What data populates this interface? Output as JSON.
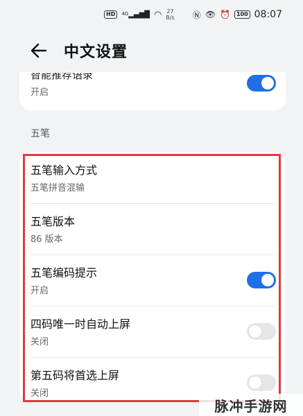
{
  "status_bar": {
    "hd_badge": "HD",
    "signal_label": "4G",
    "net_speed_value": "27",
    "net_speed_unit": "B/s",
    "battery": "100",
    "time": "08:07"
  },
  "header": {
    "title": "中文设置"
  },
  "top_card": {
    "title": "智能推荐语录",
    "subtitle": "开启",
    "toggle_on": true
  },
  "section": {
    "label": "五笔"
  },
  "rows": [
    {
      "title": "五笔输入方式",
      "subtitle": "五笔拼音混输",
      "has_toggle": false
    },
    {
      "title": "五笔版本",
      "subtitle": "86 版本",
      "has_toggle": false
    },
    {
      "title": "五笔编码提示",
      "subtitle": "开启",
      "has_toggle": true,
      "toggle_on": true
    },
    {
      "title": "四码唯一时自动上屏",
      "subtitle": "关闭",
      "has_toggle": true,
      "toggle_on": false
    },
    {
      "title": "第五码将首选上屏",
      "subtitle": "关闭",
      "has_toggle": true,
      "toggle_on": false
    }
  ],
  "colors": {
    "accent": "#1f6fe6",
    "highlight_border": "#e0393e",
    "background": "#f1f3f5"
  },
  "watermark": {
    "text": "脉冲手游网"
  }
}
